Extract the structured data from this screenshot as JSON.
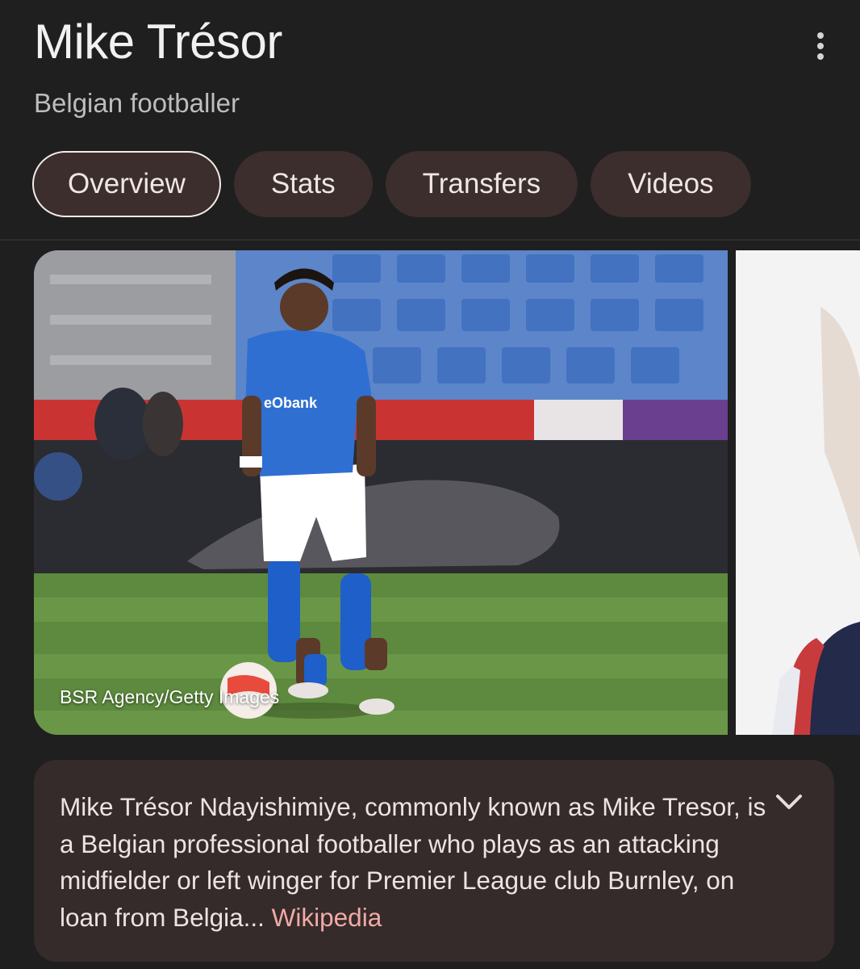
{
  "entity": {
    "title": "Mike Trésor",
    "subtitle": "Belgian footballer",
    "more_icon": "more-vert-icon"
  },
  "tabs": [
    {
      "label": "Overview",
      "active": true
    },
    {
      "label": "Stats",
      "active": false
    },
    {
      "label": "Transfers",
      "active": false
    },
    {
      "label": "Videos",
      "active": false
    }
  ],
  "images": [
    {
      "credit": "BSR Agency/Getty Images",
      "sponsor_text": "eObank"
    }
  ],
  "description": {
    "text": "Mike Trésor Ndayishimiye, commonly known as Mike Tresor, is a Belgian professional footballer who plays as an attacking midfielder or left winger for Premier League club Burnley, on loan from Belgia",
    "ellipsis": "...",
    "source_link": "Wikipedia",
    "expand_icon": "chevron-down-icon"
  },
  "colors": {
    "background": "#1f1f1f",
    "chip": "#3b2e2c",
    "card": "#342b2a",
    "link": "#f2a9a6"
  }
}
